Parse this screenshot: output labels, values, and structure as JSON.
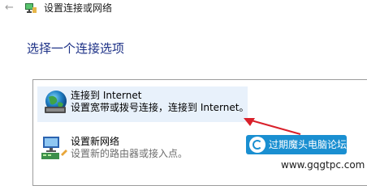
{
  "window": {
    "title": "设置连接或网络"
  },
  "heading": "选择一个连接选项",
  "options": [
    {
      "title": "连接到 Internet",
      "description": "设置宽带或拨号连接，连接到 Internet。",
      "icon": "globe-network-icon",
      "selected": true
    },
    {
      "title": "设置新网络",
      "description": "设置新的路由器或接入点。",
      "icon": "new-network-router-icon",
      "selected": false
    }
  ],
  "watermark": {
    "text": "过期魔头电脑论坛",
    "url": "www.gqgtpc.com"
  },
  "colors": {
    "heading": "#1e3287",
    "selection": "#e8f1fb",
    "arrow": "#d9202a",
    "watermark_bg": "#1a8fd1"
  }
}
